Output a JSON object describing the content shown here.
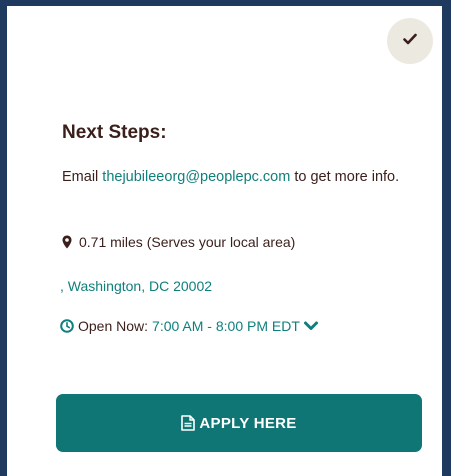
{
  "card": {
    "heading": "Next Steps:",
    "email_prefix": "Email ",
    "email": "thejubileeorg@peoplepc.com",
    "email_suffix": " to get more info.",
    "distance": "0.71 miles (Serves your local area)",
    "address": ", Washington, DC 20002",
    "hours_label": "Open Now:",
    "hours_time": "7:00 AM - 8:00 PM EDT",
    "apply_label": "APPLY HERE"
  },
  "icons": {
    "check": "checkmark-icon",
    "location": "map-pin-icon",
    "clock": "clock-icon",
    "expand": "chevron-down-icon",
    "document": "document-icon"
  },
  "colors": {
    "accent": "#0f7f7c",
    "button": "#0f7675",
    "text": "#3a1f1b",
    "frame": "#1e3a5f",
    "check_bg": "#ece9e1"
  }
}
